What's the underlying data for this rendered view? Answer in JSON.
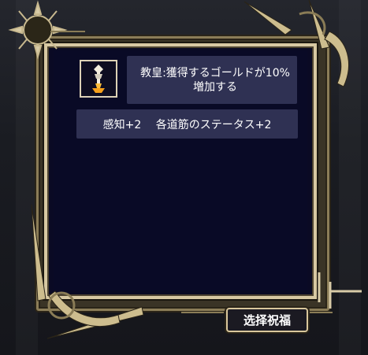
{
  "card": {
    "title_line1": "教皇:獲得するゴールドが10%",
    "title_line2": "増加する",
    "stats": "感知+2　 各道筋のステータス+2"
  },
  "buttons": {
    "select_blessing": "选择祝福"
  },
  "icons": {
    "portrait": "pope-staff-icon",
    "sun": "sun-ornament-icon",
    "moon": "crescent-moon-icon"
  },
  "colors": {
    "panel_background": "#090a26",
    "text_box": "#2f3153",
    "frame_gold": "#d7c8a2",
    "text": "#ffffff"
  }
}
